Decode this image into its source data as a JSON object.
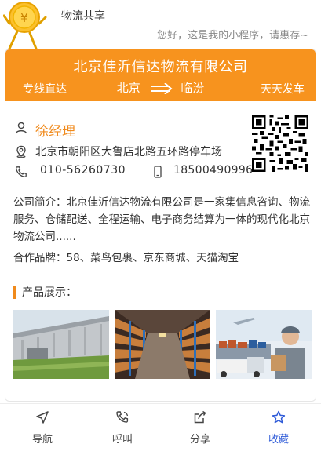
{
  "header": {
    "title": "物流共享",
    "subtitle": "您好，这是我的小程序，请惠存~",
    "mascot_icon": "coin-mascot-icon"
  },
  "banner": {
    "company_name": "北京佳沂信达物流有限公司",
    "left_tag": "专线直达",
    "origin": "北京",
    "destination": "临汾",
    "right_tag": "天天发车",
    "color": "#f7931e"
  },
  "contact": {
    "name": "徐经理",
    "address": "北京市朝阳区大鲁店北路五环路停车场",
    "phone": "010-56260730",
    "mobile": "18500490996",
    "name_color": "#f08a1c"
  },
  "intro": {
    "text": "公司简介：北京佳沂信达物流有限公司是一家集信息咨询、物流服务、仓储配送、全程运输、电子商务结算为一体的现代化北京物流公司......",
    "partners": "合作品牌：58、菜鸟包裹、京东商城、天猫淘宝"
  },
  "products": {
    "title": "产品展示：",
    "images": [
      "warehouse-building-photo",
      "warehouse-shelves-photo",
      "logistics-courier-photo"
    ]
  },
  "nav": {
    "items": [
      {
        "label": "导航",
        "icon": "navigate-icon"
      },
      {
        "label": "呼叫",
        "icon": "phone-call-icon"
      },
      {
        "label": "分享",
        "icon": "share-icon"
      },
      {
        "label": "收藏",
        "icon": "star-icon"
      }
    ],
    "active_index": 3,
    "active_color": "#2f5bd8"
  }
}
